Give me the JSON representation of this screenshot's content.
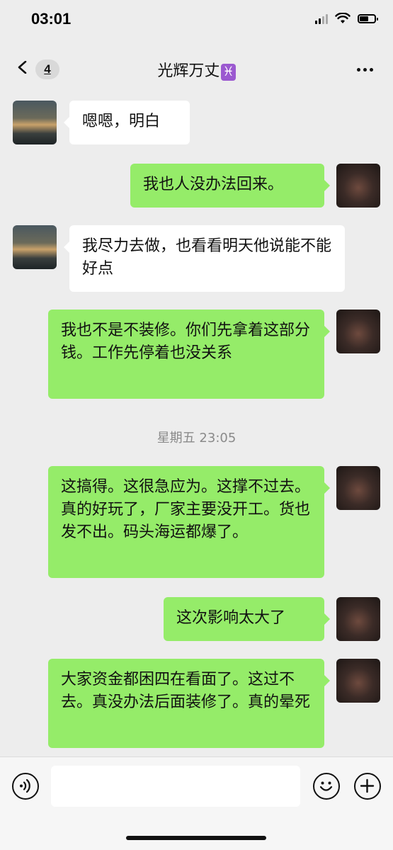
{
  "status_bar": {
    "time": "03:01",
    "icons": [
      "cellular-signal-icon",
      "wifi-icon",
      "battery-icon"
    ],
    "battery_level_percent": 65
  },
  "header": {
    "back_icon": "chevron-left-icon",
    "unread_count": "4",
    "title": "光辉万丈",
    "title_symbol": "♓",
    "more_icon": "more-dots-icon"
  },
  "messages": [
    {
      "side": "left",
      "text": "嗯嗯，明白"
    },
    {
      "side": "right",
      "text": "我也人没办法回来。"
    },
    {
      "side": "left",
      "text": "我尽力去做，也看看明天他说能不能好点"
    },
    {
      "side": "right",
      "text": "我也不是不装修。你们先拿着这部分钱。工作先停着也没关系"
    },
    {
      "side": "right",
      "text": "这搞得。这很急应为。这撑不过去。真的好玩了，厂家主要没开工。货也发不出。码头海运都爆了。"
    },
    {
      "side": "right",
      "text": "这次影响太大了"
    },
    {
      "side": "right",
      "text": "大家资金都困四在看面了。这过不去。真没办法后面装修了。真的晕死"
    }
  ],
  "timestamp": "星期五 23:05",
  "input_bar": {
    "voice_icon": "voice-input-icon",
    "emoji_icon": "emoji-icon",
    "plus_icon": "plus-icon",
    "input_value": ""
  },
  "colors": {
    "background": "#ededed",
    "bubble_self": "#95ec69",
    "bubble_other": "#ffffff"
  }
}
